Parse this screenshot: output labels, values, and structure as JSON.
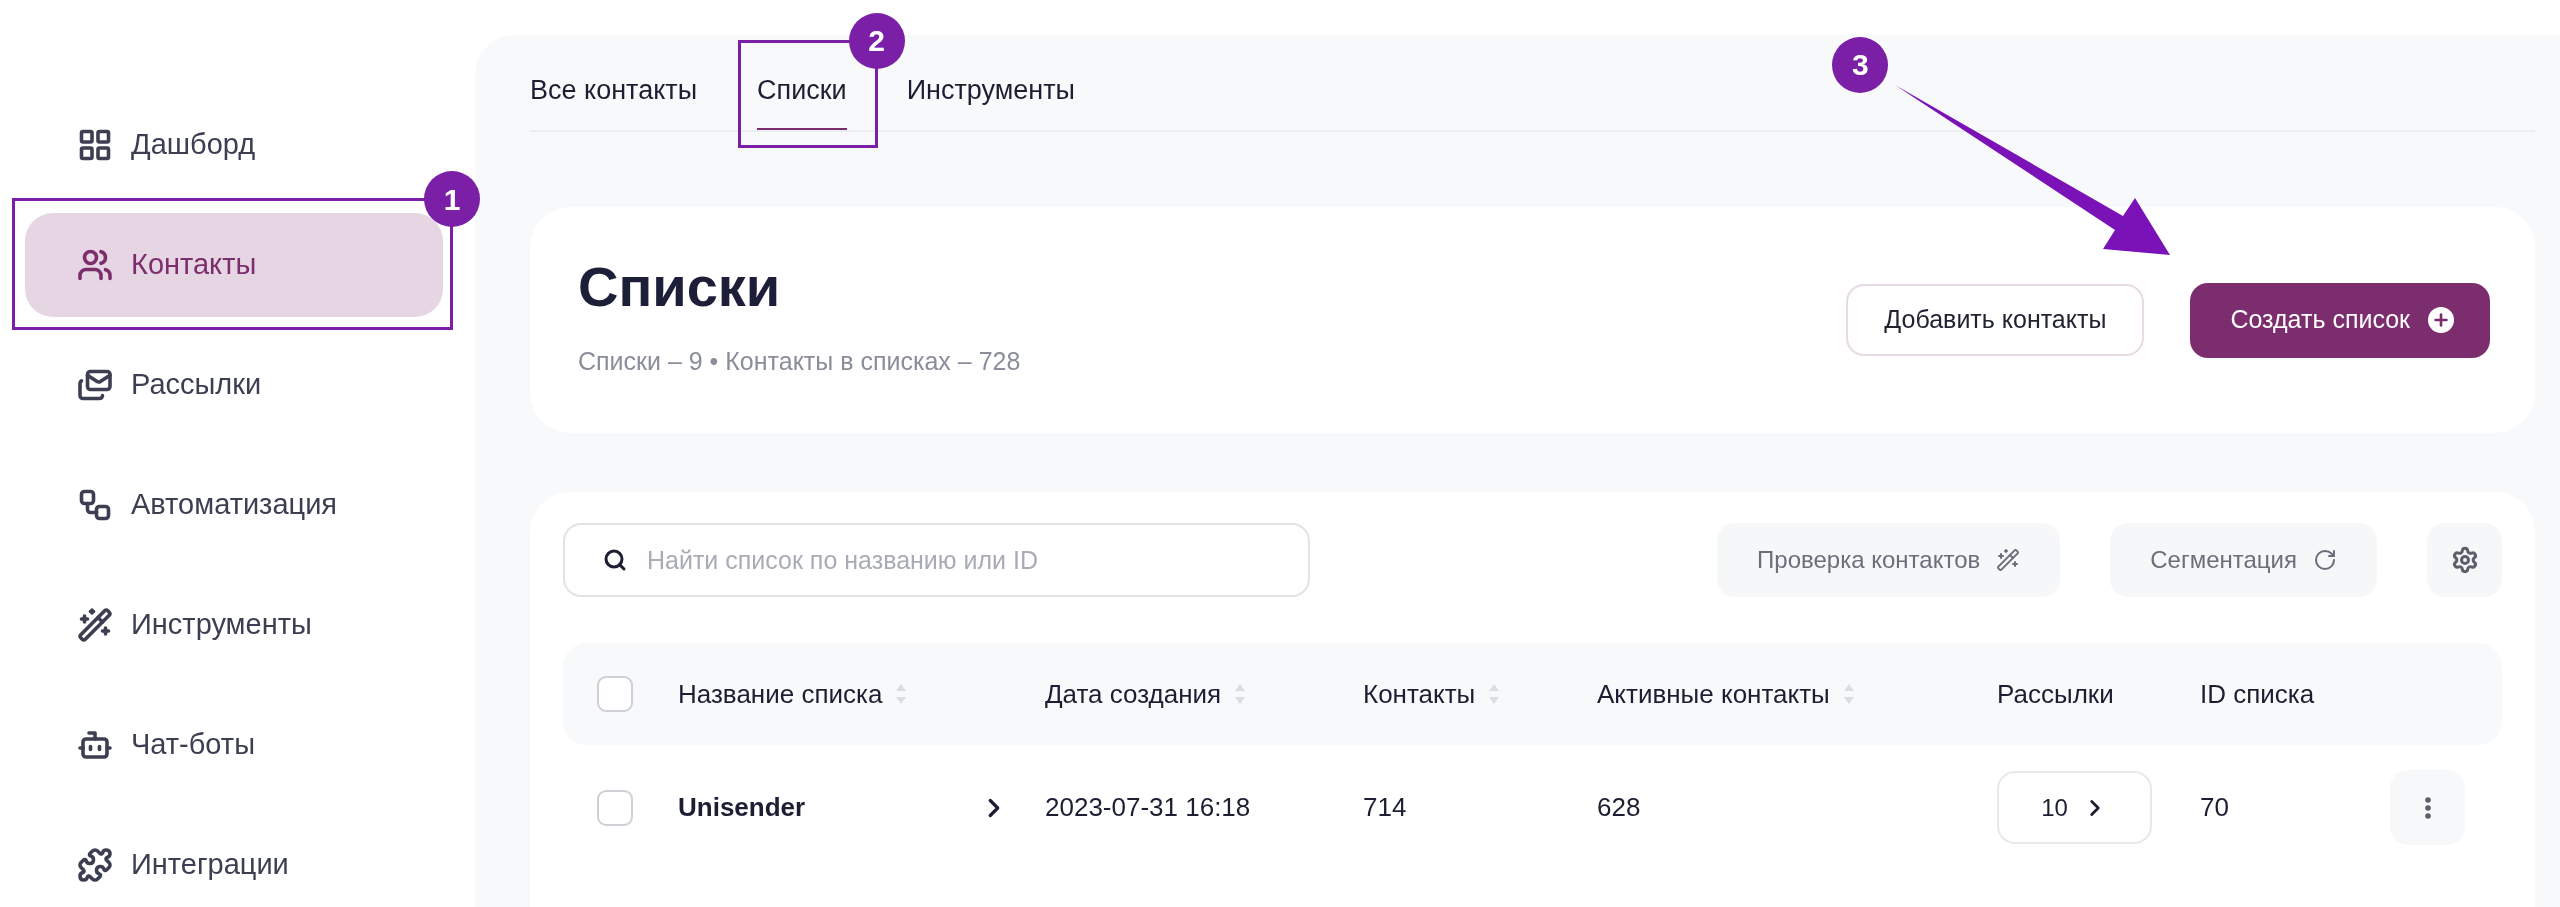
{
  "sidebar": {
    "items": [
      {
        "label": "Дашборд",
        "selected": false
      },
      {
        "label": "Контакты",
        "selected": true,
        "callout": "1"
      },
      {
        "label": "Рассылки",
        "selected": false
      },
      {
        "label": "Автоматизация",
        "selected": false
      },
      {
        "label": "Инструменты",
        "selected": false
      },
      {
        "label": "Чат-боты",
        "selected": false
      },
      {
        "label": "Интеграции",
        "selected": false
      }
    ]
  },
  "tabs": [
    {
      "label": "Все контакты",
      "selected": false
    },
    {
      "label": "Списки",
      "selected": true,
      "callout": "2"
    },
    {
      "label": "Инструменты",
      "selected": false
    }
  ],
  "header": {
    "title": "Списки",
    "subtitle": "Списки – 9 • Контакты в списках – 728",
    "add_button": "Добавить контакты",
    "create_button": {
      "label": "Создать список",
      "callout": "3"
    }
  },
  "toolbar": {
    "search": {
      "placeholder": "Найти список по названию или ID"
    },
    "buttons": [
      {
        "label": "Проверка контактов"
      },
      {
        "label": "Сегментация"
      }
    ]
  },
  "table": {
    "header_checked": false,
    "columns": [
      {
        "label": "Название списка",
        "sortable": true
      },
      {
        "label": "Дата создания",
        "sortable": true
      },
      {
        "label": "Контакты",
        "sortable": true
      },
      {
        "label": "Активные контакты",
        "sortable": true
      },
      {
        "label": "Рассылки",
        "sortable": false
      },
      {
        "label": "ID списка",
        "sortable": false
      }
    ],
    "rows": [
      {
        "checked": false,
        "name": "Unisender",
        "created": "2023-07-31 16:18",
        "contacts": "714",
        "active": "628",
        "mailings": "10",
        "id": "70"
      }
    ]
  }
}
